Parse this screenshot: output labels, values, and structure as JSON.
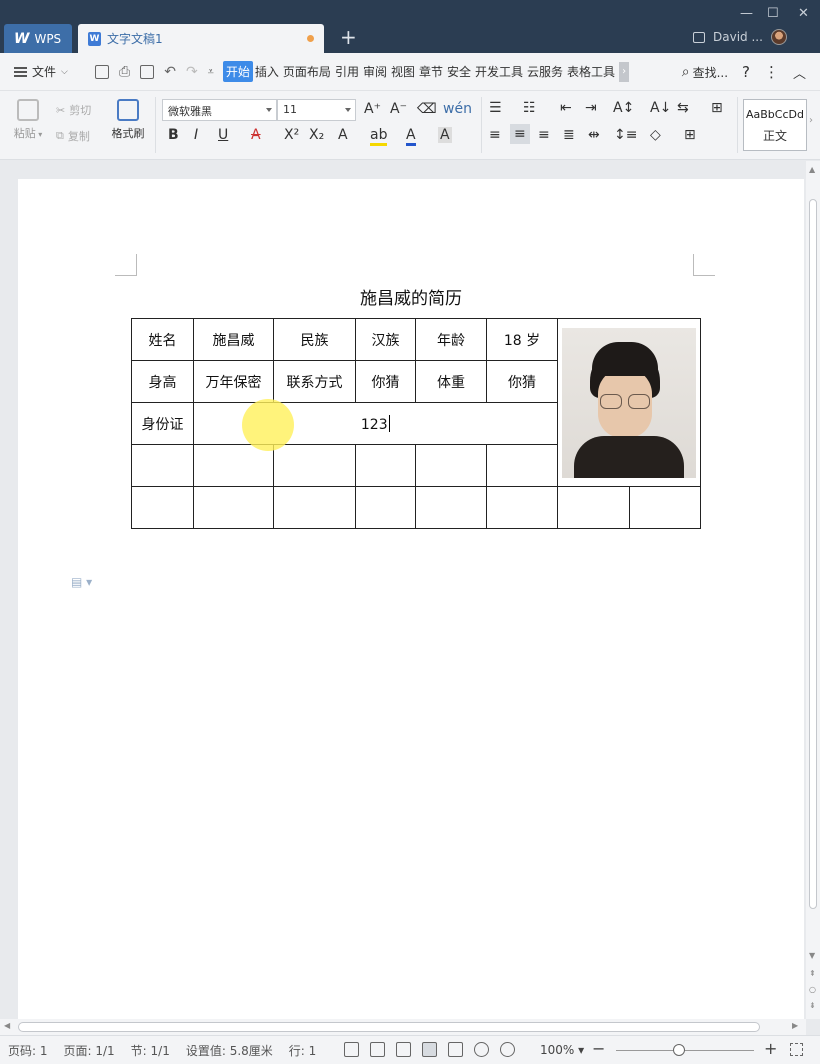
{
  "tabs": {
    "wps_label": "WPS",
    "doc_label": "文字文稿1"
  },
  "titlebar": {
    "user_name": "David ..."
  },
  "menu": {
    "file_label": "文件",
    "tabs": [
      "开始",
      "插入",
      "页面布局",
      "引用",
      "审阅",
      "视图",
      "章节",
      "安全",
      "开发工具",
      "云服务",
      "表格工具"
    ],
    "active_tab": "开始",
    "search_label": "查找..."
  },
  "ribbon": {
    "paste": "粘贴",
    "cut": "剪切",
    "copy": "复制",
    "format_painter": "格式刷",
    "font_name": "微软雅黑",
    "font_size": "11",
    "style_preview": "AaBbCcDd",
    "style_name": "正文"
  },
  "document": {
    "title": "施昌威的简历",
    "rows": [
      [
        "姓名",
        "施昌威",
        "民族",
        "汉族",
        "年龄",
        "18 岁"
      ],
      [
        "身高",
        "万年保密",
        "联系方式",
        "你猜",
        "体重",
        "你猜"
      ]
    ],
    "id_label": "身份证",
    "id_value": "123"
  },
  "statusbar": {
    "page_num": "页码: 1",
    "pages": "页面: 1/1",
    "section": "节: 1/1",
    "setting": "设置值: 5.8厘米",
    "line": "行: 1",
    "zoom": "100%",
    "zoom_fraction": 0.46
  }
}
